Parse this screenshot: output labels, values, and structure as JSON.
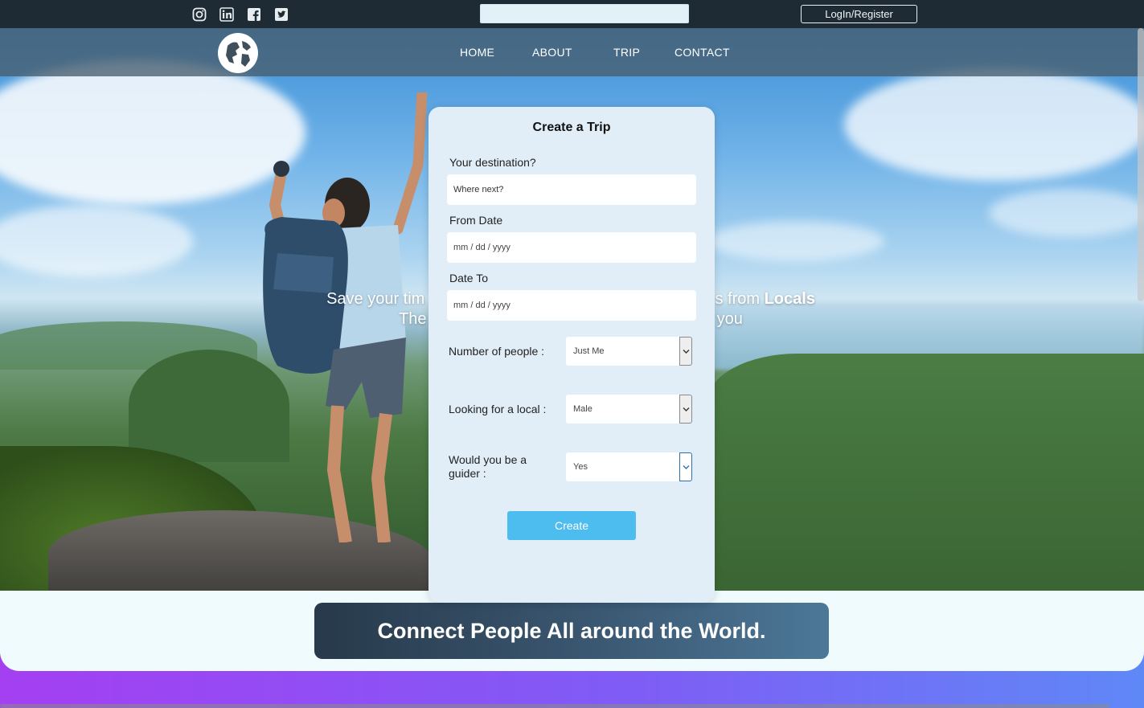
{
  "topbar": {
    "social_icons": [
      "instagram-icon",
      "linkedin-icon",
      "facebook-icon",
      "twitter-icon"
    ],
    "search_value": "",
    "login_label": "LogIn/Register"
  },
  "nav": {
    "items": [
      {
        "label": "HOME"
      },
      {
        "label": "ABOUT"
      },
      {
        "label": "TRIP"
      },
      {
        "label": "CONTACT"
      }
    ]
  },
  "hero": {
    "line1_left": "Save your tim",
    "line1_right": "s from ",
    "line1_bold": "Locals",
    "line2_left": "The",
    "line2_right": "you"
  },
  "form": {
    "title": "Create a Trip",
    "destination_label": "Your destination?",
    "destination_placeholder": "Where next?",
    "from_label": "From Date",
    "from_placeholder": "mm / dd / yyyy",
    "to_label": "Date To",
    "to_placeholder": "mm / dd / yyyy",
    "people_label": "Number of people :",
    "people_value": "Just Me",
    "local_label": "Looking for a local :",
    "local_value": "Male",
    "guider_label": "Would you be a guider :",
    "guider_value": "Yes",
    "create_label": "Create"
  },
  "banner": {
    "text": "Connect People All around the World."
  },
  "colors": {
    "topbar": "#1e2b34",
    "accent_button": "#4dbcee",
    "card": "#e2eef7",
    "footer_start": "#a43ff2",
    "footer_end": "#5f88f7"
  }
}
